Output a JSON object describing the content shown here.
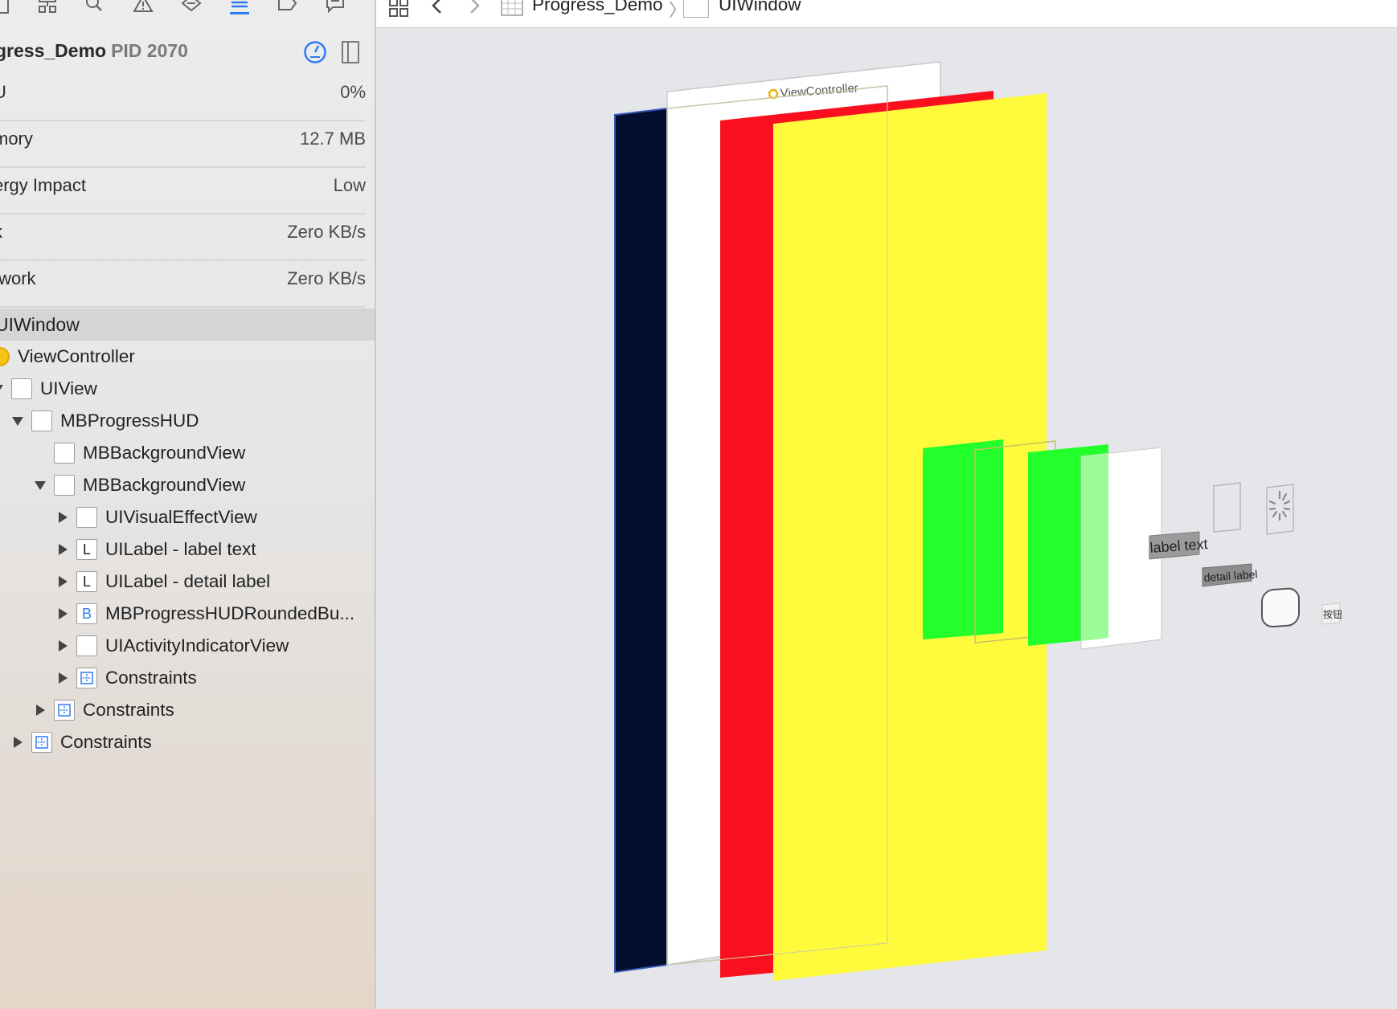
{
  "nav_icons": [
    {
      "name": "folder-icon",
      "active": false
    },
    {
      "name": "hierarchy-icon",
      "active": false
    },
    {
      "name": "search-icon",
      "active": false
    },
    {
      "name": "warning-icon",
      "active": false
    },
    {
      "name": "test-icon",
      "active": false
    },
    {
      "name": "debug-navigator-icon",
      "active": true
    },
    {
      "name": "breakpoint-icon",
      "active": false
    },
    {
      "name": "report-icon",
      "active": false
    }
  ],
  "process": {
    "name": "gress_Demo",
    "pid": "PID 2070"
  },
  "metrics": [
    {
      "label": "U",
      "value": "0%"
    },
    {
      "label": "mory",
      "value": "12.7 MB"
    },
    {
      "label": "ergy Impact",
      "value": "Low"
    },
    {
      "label": "k",
      "value": "Zero KB/s"
    },
    {
      "label": "twork",
      "value": "Zero KB/s"
    }
  ],
  "tree": {
    "root": "UIWindow",
    "view_controller": "ViewController",
    "uiview": "UIView",
    "hud": "MBProgressHUD",
    "bg_view_1": "MBBackgroundView",
    "bg_view_2": "MBBackgroundView",
    "visual_effect": "UIVisualEffectView",
    "label_text": "UILabel - label text",
    "label_detail": "UILabel - detail label",
    "rounded_button": "MBProgressHUDRoundedBu...",
    "activity_indicator": "UIActivityIndicatorView",
    "constraints_1": "Constraints",
    "constraints_2": "Constraints",
    "constraints_3": "Constraints",
    "label_glyph": "L",
    "button_glyph": "B"
  },
  "breadcrumb": {
    "project": "Progress_Demo",
    "window": "UIWindow"
  },
  "scene": {
    "vc_label": "ViewController",
    "label_text": "label text",
    "detail_label": "detail label",
    "button_text": "按钮",
    "colors": {
      "navy": "#030d2e",
      "white": "#ffffff",
      "red": "#fa0f1e",
      "yellow": "#fffb3c",
      "green": "#22ff2a",
      "light_green": "#9cfa98",
      "accent": "#2d7cf6"
    }
  }
}
